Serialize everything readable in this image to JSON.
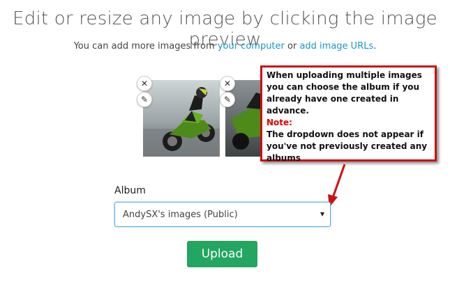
{
  "header": {
    "title": "Edit or resize any image by clicking the image preview",
    "subtitle_prefix": "You can add more images from ",
    "link_computer": "your computer",
    "subtitle_middle": " or ",
    "link_urls": "add image URLs",
    "subtitle_suffix": "."
  },
  "previews": [
    {
      "close_glyph": "✕",
      "edit_glyph": "✎"
    },
    {
      "close_glyph": "✕",
      "edit_glyph": "✎"
    }
  ],
  "callout": {
    "line1": "When uploading multiple images you can choose the album if you already have one created in advance.",
    "note_label": "Note:",
    "line2": "The dropdown does not appear if you've not previously created any albums"
  },
  "album": {
    "label": "Album",
    "selected": "AndySX's images (Public)"
  },
  "upload": {
    "label": "Upload"
  },
  "colors": {
    "link": "#1a96c9",
    "upload_bg": "#23a660",
    "callout_border": "#cc1111",
    "note": "#dd0000",
    "select_border": "#5aaee0"
  }
}
